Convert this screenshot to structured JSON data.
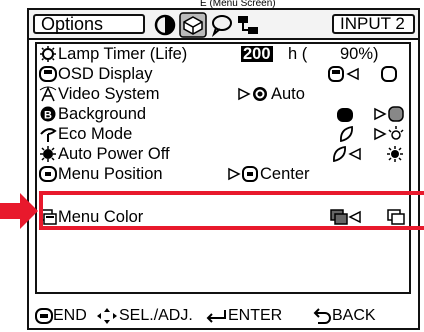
{
  "top_cut_text": "E (Menu Screen)",
  "tabs": {
    "options_label": "Options",
    "input_label": "INPUT 2",
    "icons": [
      "picture-adjust-icon",
      "options-gear-icon",
      "speech-bubble-icon",
      "network-icon"
    ]
  },
  "menu": {
    "lamp_timer": {
      "label": "Lamp Timer (Life)",
      "value": "200",
      "unit": "h (",
      "percent": "90%)"
    },
    "osd_display": {
      "label": "OSD Display"
    },
    "video_system": {
      "label": "Video System",
      "value": "Auto"
    },
    "background": {
      "label": "Background"
    },
    "eco_mode": {
      "label": "Eco Mode"
    },
    "auto_power_off": {
      "label": "Auto Power Off"
    },
    "menu_position": {
      "label": "Menu Position",
      "value": "Center"
    },
    "menu_color": {
      "label": "Menu Color"
    }
  },
  "footer": {
    "end": "END",
    "sel": "SEL./ADJ.",
    "enter": "ENTER",
    "back": "BACK"
  },
  "colors": {
    "highlight_frame": "#e8192c"
  }
}
